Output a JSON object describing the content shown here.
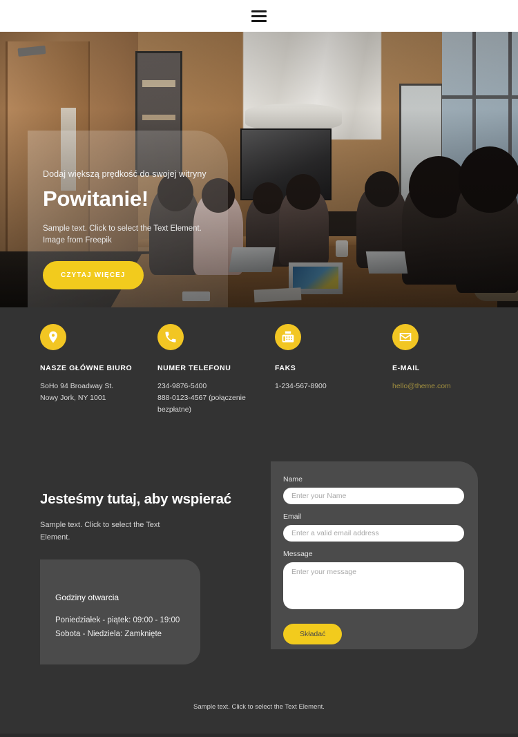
{
  "topbar": {
    "menu_icon": "hamburger-menu-icon"
  },
  "hero": {
    "kicker": "Dodaj większą prędkość do swojej witryny",
    "title": "Powitanie!",
    "subtitle": "Sample text. Click to select the Text Element.\nImage from Freepik",
    "cta_label": "CZYTAJ WIĘCEJ",
    "cta_color": "#f2cb1d"
  },
  "contact": {
    "items": [
      {
        "icon": "location-pin-icon",
        "title": "NASZE GŁÓWNE BIURO",
        "lines": "SoHo 94 Broadway St.\nNowy Jork, NY 1001",
        "link": ""
      },
      {
        "icon": "phone-icon",
        "title": "NUMER TELEFONU",
        "lines": "234-9876-5400\n888-0123-4567 (połączenie bezpłatne)",
        "link": ""
      },
      {
        "icon": "fax-icon",
        "title": "FAKS",
        "lines": "1-234-567-8900",
        "link": ""
      },
      {
        "icon": "envelope-icon",
        "title": "E-MAIL",
        "lines": "",
        "link": "hello@theme.com"
      }
    ],
    "icon_bg_color": "#f2c623",
    "link_color": "#a08e3f"
  },
  "support": {
    "heading": "Jesteśmy tutaj, aby wspierać",
    "subtext": "Sample text. Click to select the Text\nElement.",
    "hours": {
      "title": "Godziny otwarcia",
      "lines": "Poniedziałek - piątek: 09:00 - 19:00\nSobota - Niedziela: Zamknięte"
    }
  },
  "form": {
    "name_label": "Name",
    "name_placeholder": "Enter your Name",
    "name_value": "",
    "email_label": "Email",
    "email_placeholder": "Enter a valid email address",
    "email_value": "",
    "message_label": "Message",
    "message_placeholder": "Enter your message",
    "message_value": "",
    "submit_label": "Składać",
    "submit_color": "#f2cb1d"
  },
  "footer": {
    "text": "Sample text. Click to select the Text Element."
  }
}
